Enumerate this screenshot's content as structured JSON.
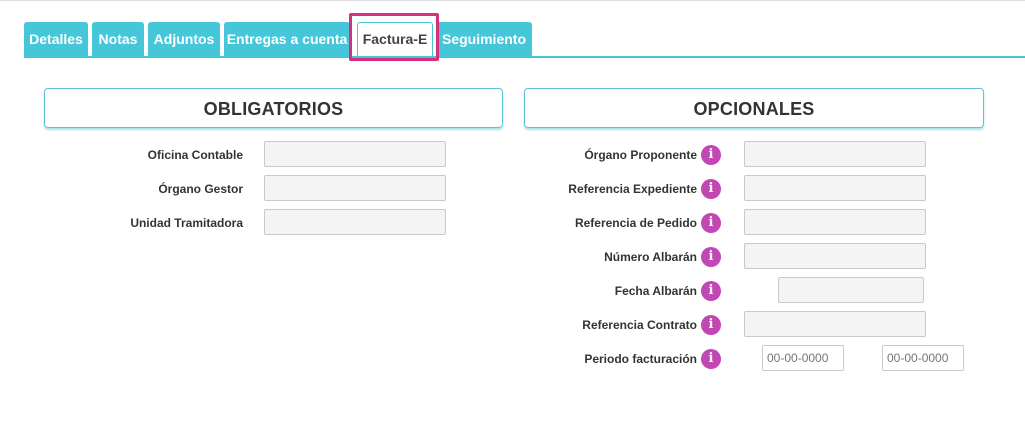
{
  "tabs": [
    {
      "label": "Detalles"
    },
    {
      "label": "Notas"
    },
    {
      "label": "Adjuntos"
    },
    {
      "label": "Entregas a cuenta"
    },
    {
      "label": "Factura-E",
      "active": true
    },
    {
      "label": "Seguimiento"
    }
  ],
  "obligatorios": {
    "title": "OBLIGATORIOS",
    "fields": [
      {
        "label": "Oficina Contable",
        "value": ""
      },
      {
        "label": "Órgano Gestor",
        "value": ""
      },
      {
        "label": "Unidad Tramitadora",
        "value": ""
      }
    ]
  },
  "opcionales": {
    "title": "OPCIONALES",
    "fields": [
      {
        "label": "Órgano Proponente",
        "value": ""
      },
      {
        "label": "Referencia Expediente",
        "value": ""
      },
      {
        "label": "Referencia de Pedido",
        "value": ""
      },
      {
        "label": "Número Albarán",
        "value": ""
      },
      {
        "label": "Fecha Albarán",
        "value": ""
      },
      {
        "label": "Referencia Contrato",
        "value": ""
      },
      {
        "label": "Periodo facturación",
        "from_placeholder": "00-00-0000",
        "to_placeholder": "00-00-0000"
      }
    ],
    "info_icon": "info-icon",
    "info_glyph": "i"
  },
  "colors": {
    "tab": "#45c6d9",
    "highlight": "#d4317a",
    "info": "#c346b5"
  }
}
